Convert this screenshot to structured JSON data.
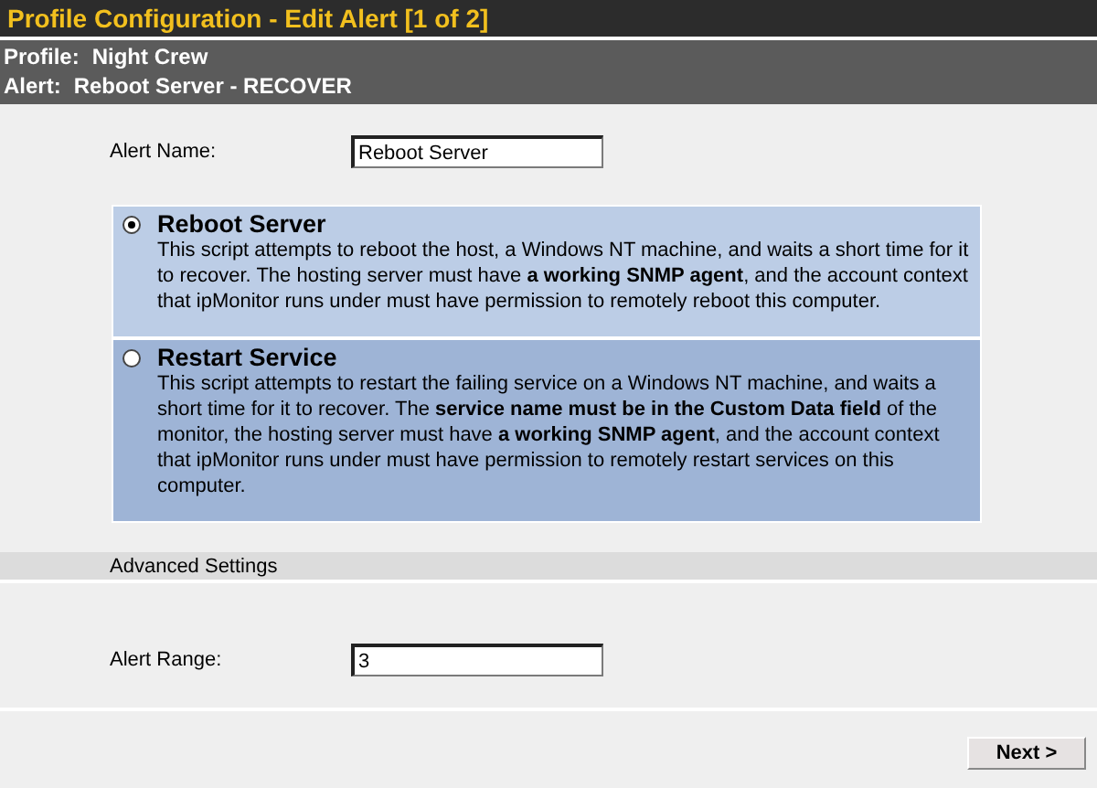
{
  "window": {
    "title": "Profile Configuration - Edit Alert [1 of 2]"
  },
  "header": {
    "profile_label": "Profile:",
    "profile_value": "Night Crew",
    "alert_label": "Alert:",
    "alert_value": "Reboot Server - RECOVER"
  },
  "alert_name": {
    "label": "Alert Name:",
    "value": "Reboot Server"
  },
  "options": [
    {
      "title": "Reboot Server",
      "description": "This script attempts to reboot the host, a Windows NT machine, and waits a short time for it to recover. The hosting server must have **a working SNMP agent**, and the account context that ipMonitor runs under must have permission to remotely reboot this computer.",
      "selected": true
    },
    {
      "title": "Restart Service",
      "description": "This script attempts to restart the failing service on a Windows NT machine, and waits a short time for it to recover. The **service name must be in the Custom Data field** of the monitor, the hosting server must have **a working SNMP agent**, and the account context that ipMonitor runs under must have permission to remotely restart services on this computer.",
      "selected": false
    }
  ],
  "advanced": {
    "title": "Advanced Settings"
  },
  "alert_range": {
    "label": "Alert Range:",
    "value": "3"
  },
  "buttons": [
    {
      "label": "Next >"
    }
  ]
}
